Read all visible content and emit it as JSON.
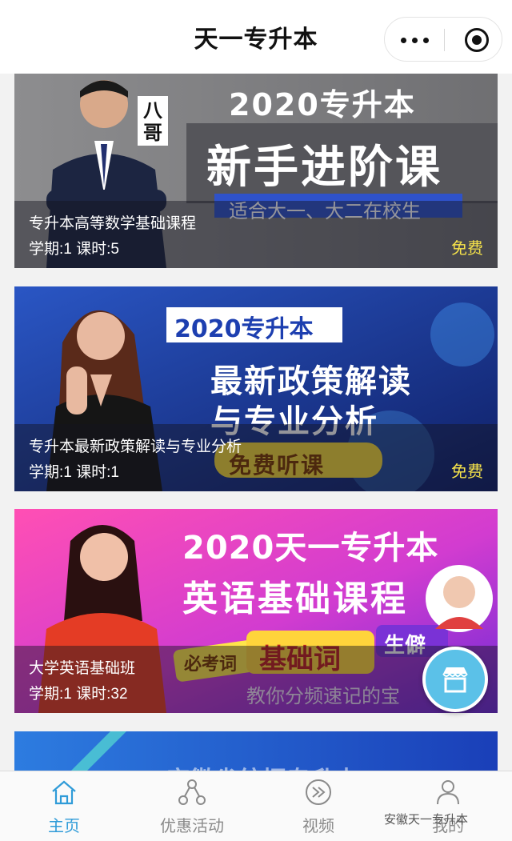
{
  "header": {
    "title": "天一专升本"
  },
  "courses": [
    {
      "name": "专升本高等数学基础课程",
      "meta": "学期:1 课时:5",
      "price": "免费",
      "banner": {
        "year_title": "2020专升本",
        "headline": "新手进阶课",
        "subline": "适合大一、大二在校生",
        "badge": "八哥"
      }
    },
    {
      "name": "专升本最新政策解读与专业分析",
      "meta": "学期:1 课时:1",
      "price": "免费",
      "banner": {
        "year_title": "2020专升本",
        "headline1": "最新政策解读",
        "headline2": "与专业分析",
        "tag": "免费听课"
      }
    },
    {
      "name": "大学英语基础班",
      "meta": "学期:1 课时:32",
      "price": "",
      "banner": {
        "line1": "2020天一专升本",
        "line2": "英语基础课程",
        "tag_a": "必考词",
        "tag_b": "基础词",
        "tag_c": "生僻",
        "subline": "教你分频速记的宝"
      }
    },
    {
      "banner": {
        "partial_text": "安徽省统招专升本"
      }
    }
  ],
  "tabbar": {
    "items": [
      {
        "label": "主页",
        "icon": "home-icon",
        "active": true
      },
      {
        "label": "优惠活动",
        "icon": "share-icon",
        "active": false
      },
      {
        "label": "视频",
        "icon": "play-icon",
        "active": false
      },
      {
        "label": "我的",
        "icon": "user-icon",
        "active": false
      }
    ],
    "watermark": "安徽天一专升本"
  },
  "colors": {
    "accent": "#2f9bd8",
    "price": "#f4e14a",
    "fab": "#5bc1e8"
  }
}
